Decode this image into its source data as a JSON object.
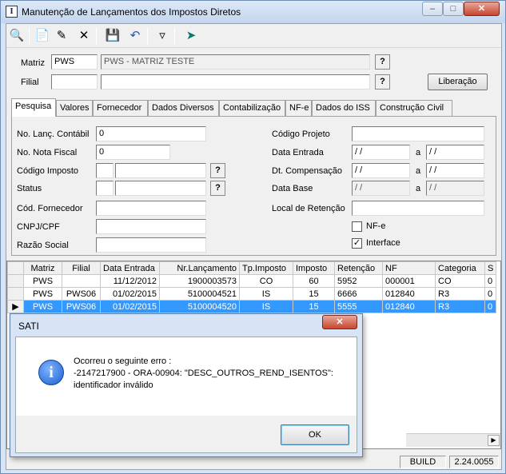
{
  "window": {
    "title": "Manutenção de Lançamentos dos Impostos Diretos",
    "icon_glyph": "I"
  },
  "toolbar": {
    "icons": [
      "binoculars-icon",
      "new-doc-icon",
      "edit-icon",
      "delete-icon",
      "save-icon",
      "undo-icon",
      "filter-icon",
      "exit-icon"
    ]
  },
  "header": {
    "matriz_label": "Matriz",
    "matriz_code": "PWS",
    "matriz_name": "PWS - MATRIZ TESTE",
    "filial_label": "Filial",
    "filial_code": "",
    "filial_name": "",
    "q": "?",
    "liberacao": "Liberação"
  },
  "tabs": [
    "Pesquisa",
    "Valores",
    "Fornecedor",
    "Dados Diversos",
    "Contabilização",
    "NF-e",
    "Dados do ISS",
    "Construção Civil"
  ],
  "form": {
    "no_lanc_label": "No. Lanç. Contábil",
    "no_lanc": "0",
    "no_nota_label": "No. Nota Fiscal",
    "no_nota": "0",
    "cod_imposto_label": "Código Imposto",
    "status_label": "Status",
    "cod_fornecedor_label": "Cód. Fornecedor",
    "cnpj_label": "CNPJ/CPF",
    "razao_label": "Razão Social",
    "cod_projeto_label": "Código Projeto",
    "data_entrada_label": "Data Entrada",
    "dt_comp_label": "Dt. Compensação",
    "data_base_label": "Data Base",
    "local_ret_label": "Local de Retenção",
    "date_blank": " / /",
    "a": "a",
    "nfe_label": "NF-e",
    "nfe_checked": false,
    "interface_label": "Interface",
    "interface_checked": true
  },
  "grid": {
    "columns": [
      "Matriz",
      "Filial",
      "Data Entrada",
      "Nr.Lançamento",
      "Tp.Imposto",
      "Imposto",
      "Retenção",
      "NF",
      "Categoria",
      "S"
    ],
    "rows": [
      [
        "PWS",
        "",
        "11/12/2012",
        "1900003573",
        "CO",
        "60",
        "5952",
        "000001",
        "CO",
        "0"
      ],
      [
        "PWS",
        "PWS06",
        "01/02/2015",
        "5100004521",
        "IS",
        "15",
        "6666",
        "012840",
        "R3",
        "0"
      ],
      [
        "PWS",
        "PWS06",
        "01/02/2015",
        "5100004520",
        "IS",
        "15",
        "5555",
        "012840",
        "R3",
        "0"
      ]
    ],
    "selected_row": 2
  },
  "status": {
    "build_label": "BUILD",
    "version": "2.24.0055"
  },
  "dialog": {
    "title": "SATI",
    "line1": "Ocorreu o seguinte erro :",
    "line2": "-2147217900 - ORA-00904: \"DESC_OUTROS_REND_ISENTOS\":",
    "line3": "identificador inválido",
    "ok": "OK"
  }
}
